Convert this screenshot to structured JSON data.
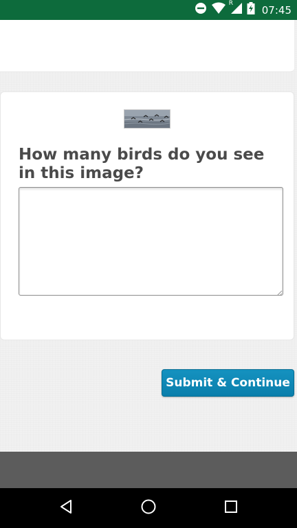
{
  "status_bar": {
    "time": "07:45",
    "roaming_indicator": "R",
    "icons": [
      "do-not-disturb-icon",
      "wifi-icon",
      "signal-icon",
      "battery-charging-icon"
    ]
  },
  "survey": {
    "image_alt": "birds in flight over water",
    "question": "How many birds do you see in this image?",
    "answer_value": "",
    "submit_label": "Submit & Continue"
  },
  "navigation": {
    "buttons": [
      "back-icon",
      "home-icon",
      "recents-icon"
    ]
  },
  "colors": {
    "status_bar": "#0d6b3c",
    "accent_button": "#0a87b6",
    "question_text": "#4a4a4a",
    "footer": "#5c5c5c"
  }
}
